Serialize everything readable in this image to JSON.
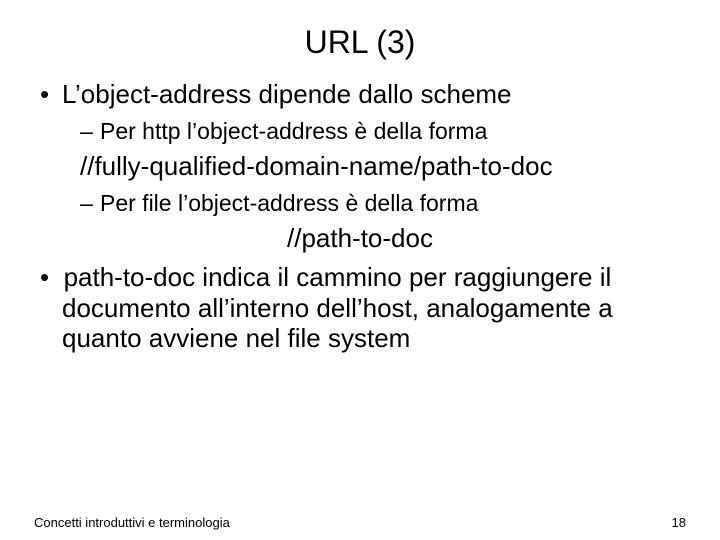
{
  "title": "URL (3)",
  "b1": "L’object-address dipende dallo scheme",
  "b1a": "Per http l’object-address è della forma",
  "fmt1": "//fully-qualified-domain-name/path-to-doc",
  "b1b": "Per file l’object-address è della forma",
  "fmt2": "//path-to-doc",
  "b2_pre": "•  ",
  "b2": "path-to-doc indica il cammino per raggiungere il documento all’interno dell’host, analogamente a quanto avviene nel file system",
  "footer_left": "Concetti introduttivi e terminologia",
  "footer_right": "18"
}
